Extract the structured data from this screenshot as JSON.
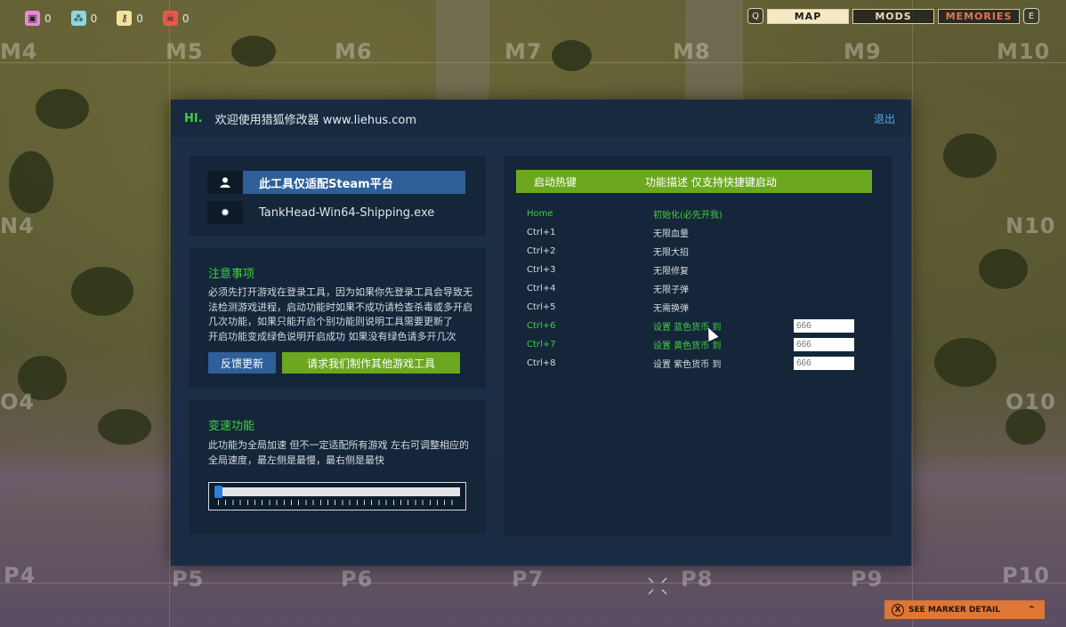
{
  "counters": [
    {
      "icon": "badge-square-icon",
      "value": "0",
      "color": "#e58ad8"
    },
    {
      "icon": "cluster-icon",
      "value": "0",
      "color": "#8ad6e5"
    },
    {
      "icon": "key-icon",
      "value": "0",
      "color": "#f3e2a0"
    },
    {
      "icon": "skull-icon",
      "value": "0",
      "color": "#e45a4a"
    }
  ],
  "nav": {
    "left_key": "Q",
    "right_key": "E",
    "tabs": [
      "MAP",
      "MODS",
      "MEMORIES"
    ]
  },
  "map_labels": {
    "row1": [
      "M4",
      "M5",
      "M6",
      "M7",
      "M8",
      "M9",
      "M10"
    ],
    "row2": [
      "N4",
      "N10"
    ],
    "row3": [
      "O4",
      "O10"
    ],
    "row4": [
      "P4",
      "P5",
      "P6",
      "P7",
      "P8",
      "P9",
      "P10"
    ]
  },
  "dialog": {
    "hi": "HI.",
    "title": "欢迎使用猎狐修改器 www.liehus.com",
    "exit": "退出",
    "info": {
      "steam_label": "此工具仅适配Steam平台",
      "process_name": "TankHead-Win64-Shipping.exe",
      "user_icon": "user-icon",
      "gear_icon": "gear-icon"
    },
    "notice": {
      "title": "注意事项",
      "lines": [
        "必须先打开游戏在登录工具，因为如果你先登录工具会导致无",
        "法检测游戏进程，启动功能时如果不成功请检查杀毒或多开启",
        "几次功能，如果只能开启个别功能则说明工具需要更新了",
        "开启功能变成绿色说明开启成功 如果没有绿色请多开几次"
      ],
      "feedback_button": "反馈更新",
      "request_button": "请求我们制作其他游戏工具"
    },
    "speed": {
      "title": "变速功能",
      "lines": [
        "此功能为全局加速 但不一定适配所有游戏 左右可调整相应的",
        "全局速度，最左侧是最慢，最右侧是最快"
      ],
      "value": 0.0
    },
    "hotkeys": {
      "header_key": "启动热键",
      "header_desc": "功能描述 仅支持快捷键启动",
      "rows": [
        {
          "key": "Home",
          "desc": "初始化(必先开我)",
          "active": true,
          "input": null
        },
        {
          "key": "Ctrl+1",
          "desc": "无限血量",
          "active": false,
          "input": null
        },
        {
          "key": "Ctrl+2",
          "desc": "无限大招",
          "active": false,
          "input": null
        },
        {
          "key": "Ctrl+3",
          "desc": "无限修复",
          "active": false,
          "input": null
        },
        {
          "key": "Ctrl+4",
          "desc": "无限子弹",
          "active": false,
          "input": null
        },
        {
          "key": "Ctrl+5",
          "desc": "无需换弹",
          "active": false,
          "input": null
        },
        {
          "key": "Ctrl+6",
          "desc": "设置 蓝色货币 到",
          "active": true,
          "input": "666"
        },
        {
          "key": "Ctrl+7",
          "desc": "设置 黄色货币 到",
          "active": true,
          "input": "666"
        },
        {
          "key": "Ctrl+8",
          "desc": "设置 紫色货币 到",
          "active": false,
          "input": "666"
        }
      ]
    }
  },
  "marker_hint": {
    "key": "X",
    "label": "SEE MARKER DETAIL"
  }
}
